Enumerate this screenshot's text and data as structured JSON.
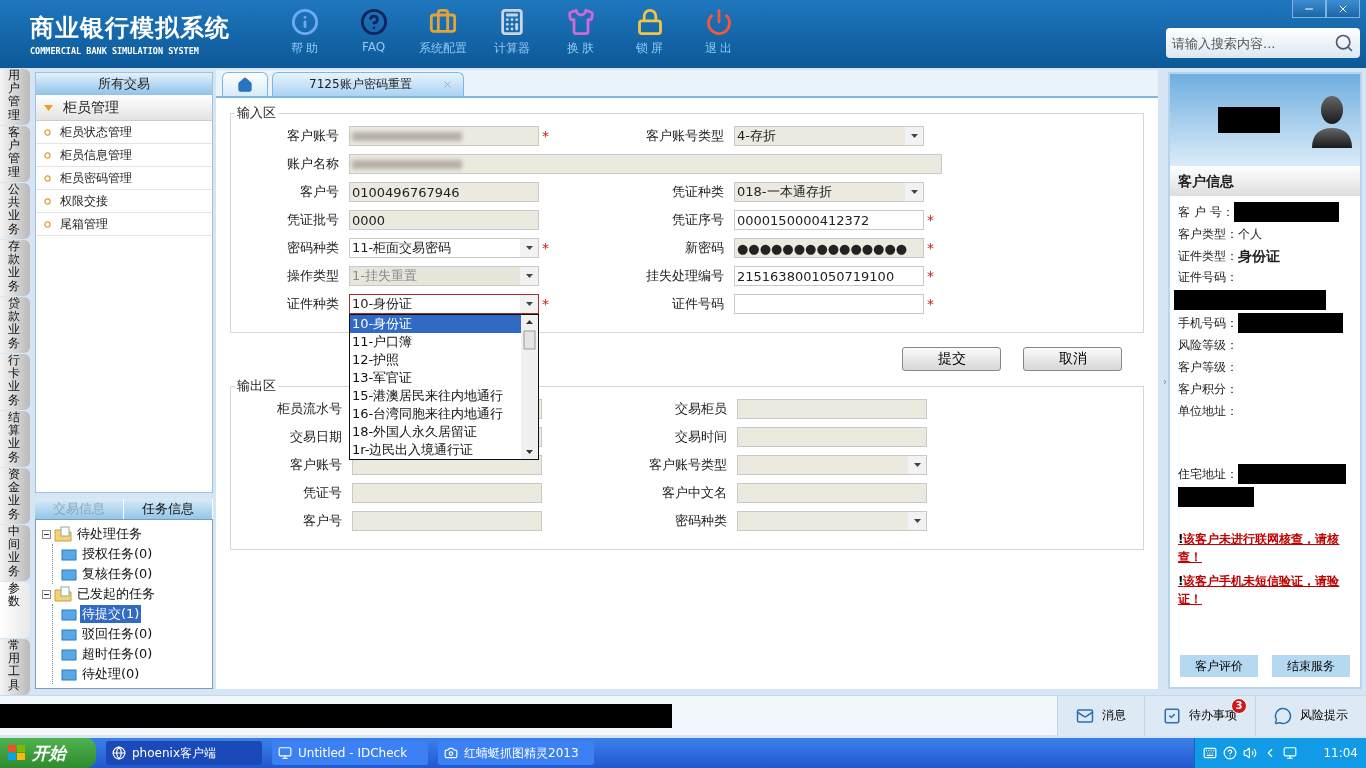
{
  "app": {
    "title": "商业银行模拟系统",
    "subtitle": "COMMERCIAL BANK SIMULATION SYSTEM"
  },
  "toolbar": [
    {
      "label": "帮 助",
      "kind": "help"
    },
    {
      "label": "FAQ",
      "kind": "faq"
    },
    {
      "label": "系统配置",
      "kind": "config"
    },
    {
      "label": "计算器",
      "kind": "calculator"
    },
    {
      "label": "换 肤",
      "kind": "skin"
    },
    {
      "label": "锁 屏",
      "kind": "lock"
    },
    {
      "label": "退 出",
      "kind": "exit"
    }
  ],
  "search": {
    "placeholder": "请输入搜索内容..."
  },
  "side_tabs": [
    {
      "label": "用户管理",
      "selected": false
    },
    {
      "label": "客户管理",
      "selected": false
    },
    {
      "label": "公共业务",
      "selected": false
    },
    {
      "label": "存款业务",
      "selected": false
    },
    {
      "label": "贷款业务",
      "selected": false
    },
    {
      "label": "行卡业务",
      "selected": false
    },
    {
      "label": "结算业务",
      "selected": false
    },
    {
      "label": "资金业务",
      "selected": false
    },
    {
      "label": "中间业务",
      "selected": false
    },
    {
      "label": "参数",
      "selected": true
    },
    {
      "label": "常用工具",
      "selected": false
    }
  ],
  "menu": {
    "title": "所有交易",
    "group": {
      "label": "柜员管理",
      "expanded": true
    },
    "items": [
      "柜员状态管理",
      "柜员信息管理",
      "柜员密码管理",
      "权限交接",
      "尾箱管理"
    ]
  },
  "task_panel": {
    "tabs": [
      {
        "label": "交易信息",
        "selected": false
      },
      {
        "label": "任务信息",
        "selected": true
      }
    ],
    "tree": [
      {
        "label": "待处理任务",
        "selected": false,
        "expanded": true,
        "children": [
          {
            "label": "授权任务(0)",
            "selected": false
          },
          {
            "label": "复核任务(0)",
            "selected": false
          }
        ]
      },
      {
        "label": "已发起的任务",
        "selected": false,
        "expanded": true,
        "children": [
          {
            "label": "待提交(1)",
            "selected": true
          },
          {
            "label": "驳回任务(0)",
            "selected": false
          },
          {
            "label": "超时任务(0)",
            "selected": false
          },
          {
            "label": "待处理(0)",
            "selected": false
          }
        ]
      }
    ]
  },
  "doc_tabs": [
    {
      "kind": "home",
      "selected": false
    },
    {
      "kind": "page",
      "label": "7125账户密码重置",
      "selected": true
    }
  ],
  "input_area": {
    "title": "输入区",
    "fields": [
      {
        "label": "客户账号",
        "kind": "text",
        "readonly": true,
        "disabled": false,
        "redacted": true,
        "required_mark": "*"
      },
      {
        "label": "客户账号类型",
        "kind": "select",
        "readonly": true,
        "disabled": false,
        "value": "4-存折"
      },
      {
        "label": "账户名称",
        "kind": "text",
        "readonly": true,
        "disabled": false,
        "redacted": true,
        "wide": true
      },
      {
        "label": "客户号",
        "kind": "text",
        "readonly": true,
        "disabled": false,
        "value": "0100496767946"
      },
      {
        "label": "凭证种类",
        "kind": "select",
        "readonly": true,
        "disabled": false,
        "value": "018-一本通存折"
      },
      {
        "label": "凭证批号",
        "kind": "text",
        "readonly": true,
        "disabled": false,
        "value": "0000"
      },
      {
        "label": "凭证序号",
        "kind": "text",
        "readonly": false,
        "disabled": false,
        "value": "0000150000412372",
        "required_mark": "*"
      },
      {
        "label": "密码种类",
        "kind": "select",
        "readonly": false,
        "disabled": false,
        "value": "11-柜面交易密码",
        "required_mark": "*"
      },
      {
        "label": "新密码",
        "kind": "password",
        "readonly": true,
        "disabled": false,
        "value": "●●●●●●●●●●●●●●●",
        "required_mark": "*"
      },
      {
        "label": "操作类型",
        "kind": "select",
        "readonly": true,
        "disabled": true,
        "value": "1-挂失重置"
      },
      {
        "label": "挂失处理编号",
        "kind": "text",
        "readonly": false,
        "disabled": false,
        "value": "2151638001050719100",
        "required_mark": "*"
      },
      {
        "label": "证件种类",
        "kind": "select",
        "readonly": false,
        "disabled": false,
        "value": "10-身份证",
        "required_mark": "*",
        "open": true,
        "options": [
          {
            "label": "10-身份证",
            "selected": true
          },
          {
            "label": "11-户口簿",
            "selected": false
          },
          {
            "label": "12-护照",
            "selected": false
          },
          {
            "label": "13-军官证",
            "selected": false
          },
          {
            "label": "15-港澳居民来往内地通行",
            "selected": false
          },
          {
            "label": "16-台湾同胞来往内地通行",
            "selected": false
          },
          {
            "label": "18-外国人永久居留证",
            "selected": false
          },
          {
            "label": "1r-边民出入境通行证",
            "selected": false
          }
        ]
      },
      {
        "label": "证件号码",
        "kind": "text",
        "readonly": false,
        "disabled": false,
        "required_mark": "*"
      }
    ]
  },
  "actions": [
    "提交",
    "取消"
  ],
  "output_area": {
    "title": "输出区",
    "fields": [
      {
        "label": "柜员流水号",
        "kind": "text",
        "readonly": true
      },
      {
        "label": "交易柜员",
        "kind": "text",
        "readonly": true
      },
      {
        "label": "交易日期",
        "kind": "text",
        "readonly": true
      },
      {
        "label": "交易时间",
        "kind": "text",
        "readonly": true
      },
      {
        "label": "客户账号",
        "kind": "text",
        "readonly": true
      },
      {
        "label": "客户账号类型",
        "kind": "select",
        "readonly": true
      },
      {
        "label": "凭证号",
        "kind": "text",
        "readonly": true
      },
      {
        "label": "客户中文名",
        "kind": "text",
        "readonly": true
      },
      {
        "label": "客户号",
        "kind": "text",
        "readonly": true
      },
      {
        "label": "密码种类",
        "kind": "select",
        "readonly": true
      }
    ]
  },
  "customer": {
    "title": "客户信息",
    "info": [
      {
        "label": "客 户 号：",
        "kind": "redacted"
      },
      {
        "label": "客户类型：",
        "kind": "text",
        "value": "个人"
      },
      {
        "label": "证件类型：",
        "kind": "emphasis",
        "value": "身份证"
      },
      {
        "label": "证件号码：",
        "kind": "redacted_below"
      },
      {
        "label": "手机号码：",
        "kind": "redacted"
      },
      {
        "label": "风险等级：",
        "kind": "empty"
      },
      {
        "label": "客户等级：",
        "kind": "empty"
      },
      {
        "label": "客户积分：",
        "kind": "empty"
      },
      {
        "label": "单位地址：",
        "kind": "address_empty"
      },
      {
        "label": "住宅地址：",
        "kind": "redacted_address"
      }
    ],
    "warning_mark": "!",
    "warnings": [
      "该客户未进行联网核查，请核查！",
      "该客户手机未短信验证，请验证！"
    ],
    "buttons": [
      "客户评价",
      "结束服务"
    ]
  },
  "status_bar": {
    "items": [
      {
        "label": "消息",
        "kind": "message"
      },
      {
        "label": "待办事项",
        "kind": "todo",
        "badge": "3"
      },
      {
        "label": "风险提示",
        "kind": "risk"
      }
    ]
  },
  "taskbar": {
    "start": "开始",
    "tasks": [
      {
        "label": "phoenix客户端",
        "kind": "browser",
        "selected": true
      },
      {
        "label": "Untitled - IDCheck",
        "kind": "app",
        "selected": false
      },
      {
        "label": "红蜻蜓抓图精灵2013",
        "kind": "capture",
        "selected": false
      }
    ],
    "clock": "11:04"
  }
}
